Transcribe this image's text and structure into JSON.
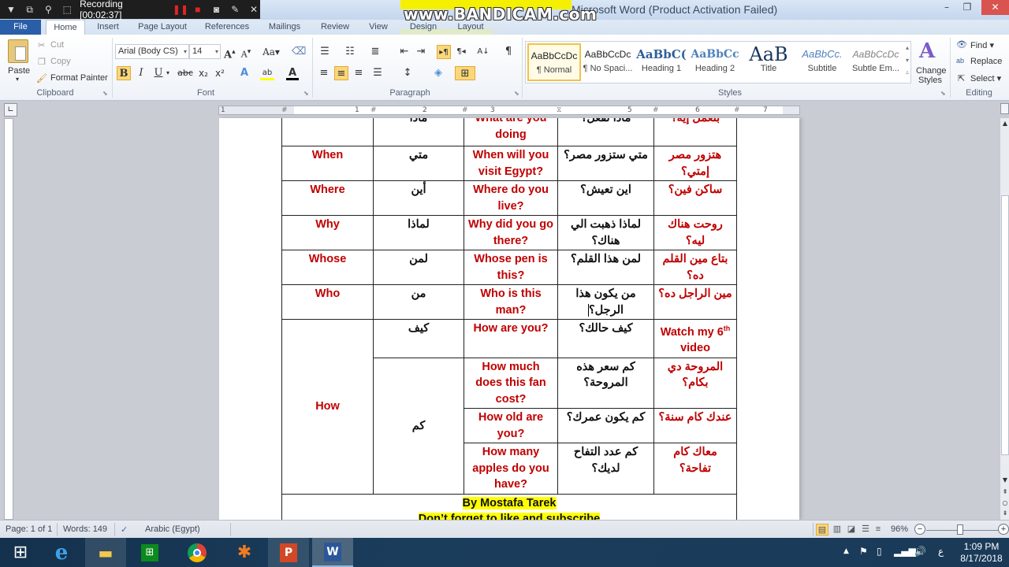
{
  "window": {
    "title": "Microsoft Word (Product Activation Failed)",
    "minimize_label": "–",
    "maximize_label": "❐",
    "close_label": "✕"
  },
  "recorder": {
    "status": "Recording [00:02:37]",
    "watermark": "www.BANDICAM.com",
    "icons": [
      "dropdown-icon",
      "window-icon",
      "search-icon",
      "region-icon",
      "pause-icon",
      "stop-icon",
      "camera-icon",
      "pencil-icon",
      "close-icon"
    ]
  },
  "ribbon_tabs": [
    {
      "label": "File"
    },
    {
      "label": "Home"
    },
    {
      "label": "Insert"
    },
    {
      "label": "Page Layout"
    },
    {
      "label": "References"
    },
    {
      "label": "Mailings"
    },
    {
      "label": "Review"
    },
    {
      "label": "View"
    },
    {
      "label": "Design"
    },
    {
      "label": "Layout"
    }
  ],
  "clipboard": {
    "paste_label": "Paste",
    "cut_label": "Cut",
    "copy_label": "Copy",
    "format_painter_label": "Format Painter",
    "group_label": "Clipboard"
  },
  "font": {
    "font_name": "Arial (Body CS)",
    "font_size": "14",
    "group_label": "Font",
    "bold_active": true
  },
  "paragraph": {
    "group_label": "Paragraph",
    "align_center_active": true,
    "rtl_active": true
  },
  "styles": {
    "group_label": "Styles",
    "items": [
      {
        "preview": "AaBbCcDc",
        "name": "¶ Normal",
        "selected": true
      },
      {
        "preview": "AaBbCcDc",
        "name": "¶ No Spaci...",
        "selected": false
      },
      {
        "preview": "AaBbC(",
        "name": "Heading 1",
        "selected": false
      },
      {
        "preview": "AaBbCc",
        "name": "Heading 2",
        "selected": false
      },
      {
        "preview": "AaB",
        "name": "Title",
        "selected": false
      },
      {
        "preview": "AaBbCc.",
        "name": "Subtitle",
        "selected": false
      },
      {
        "preview": "AaBbCcDc",
        "name": "Subtle Em...",
        "selected": false
      }
    ],
    "change_styles_label": "Change Styles"
  },
  "editing": {
    "group_label": "Editing",
    "find_label": "Find",
    "replace_label": "Replace",
    "select_label": "Select"
  },
  "ruler": {
    "ticks": [
      "1",
      "1",
      "2",
      "3",
      "4",
      "5",
      "6",
      "7"
    ]
  },
  "document": {
    "colors": {
      "english": "#c00000",
      "arabic": "#111111",
      "highlight": "#ffff00"
    },
    "partial_row": {
      "col1": "",
      "col2": "ماذا",
      "col3": "What are you doing",
      "col4": "ماذا تفعل؟",
      "col5": "بتعمل إيه؟"
    },
    "rows": [
      {
        "word": "When",
        "arabic": "متي",
        "example": "When will you visit Egypt?",
        "translation": "متي ستزور مصر؟",
        "colloquial": "هتزور مصر إمتي؟"
      },
      {
        "word": "Where",
        "arabic": "أين",
        "example": "Where do you live?",
        "translation": "اين تعيش؟",
        "colloquial": "ساكن فين؟"
      },
      {
        "word": "Why",
        "arabic": "لماذا",
        "example": "Why did you go there?",
        "translation": "لماذا ذهبت الي هناك؟",
        "colloquial": "روحت هناك ليه؟"
      },
      {
        "word": "Whose",
        "arabic": "لمن",
        "example": "Whose pen is this?",
        "translation": "لمن هذا القلم؟",
        "colloquial": "بتاع مين القلم ده؟"
      },
      {
        "word": "Who",
        "arabic": "من",
        "example": "Who is this man?",
        "translation": "من يكون هذا الرجل؟",
        "colloquial": "مين الراجل ده؟"
      }
    ],
    "how_group": {
      "word": "How",
      "sub": [
        {
          "arabic": "كيف",
          "examples": [
            {
              "example": "How are you?",
              "translation": "كيف حالك؟",
              "colloquial_pre": "Watch my 6",
              "colloquial_sup": "th",
              "colloquial_post": " video"
            }
          ]
        },
        {
          "arabic": "كم",
          "examples": [
            {
              "example": "How much does this fan cost?",
              "translation": "كم سعر هذه المروحة؟",
              "colloquial": "المروحة دي بكام؟"
            },
            {
              "example": "How old are you?",
              "translation": "كم يكون عمرك؟",
              "colloquial": "عندك كام سنة؟"
            },
            {
              "example": "How many apples do you have?",
              "translation": "كم عدد التفاح لديك؟",
              "colloquial": "معاك كام تفاحة؟"
            }
          ]
        }
      ]
    },
    "footer": {
      "author": "By Mostafa Tarek",
      "cta": "Don’t forget to like and subscribe"
    }
  },
  "statusbar": {
    "page": "Page: 1 of 1",
    "words": "Words: 149",
    "language": "Arabic (Egypt)",
    "zoom": "96%",
    "zoom_percent": 96
  },
  "taskbar": {
    "apps": [
      {
        "name": "start"
      },
      {
        "name": "internet-explorer"
      },
      {
        "name": "file-explorer"
      },
      {
        "name": "store"
      },
      {
        "name": "chrome"
      },
      {
        "name": "avast"
      },
      {
        "name": "powerpoint"
      },
      {
        "name": "word"
      }
    ],
    "input_lang": "ع",
    "time": "1:09 PM",
    "date": "8/17/2018"
  }
}
